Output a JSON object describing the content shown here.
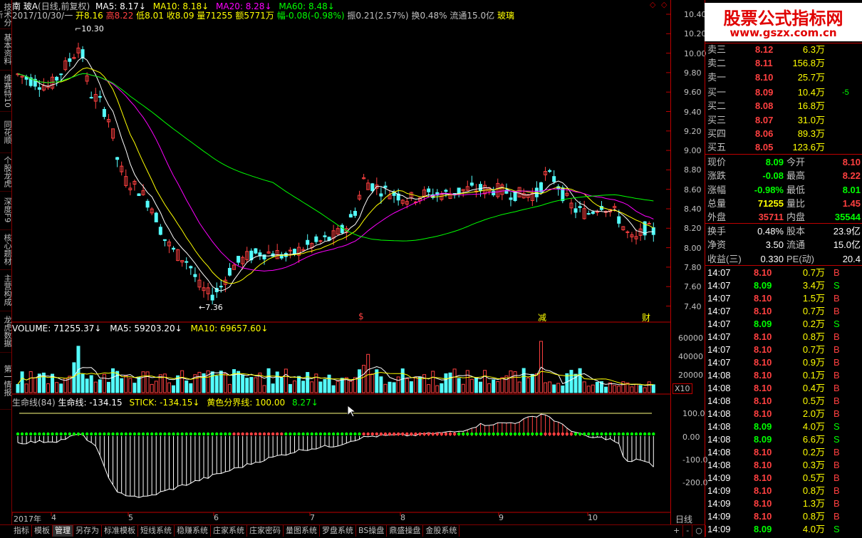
{
  "left_tabs": [
    "技术分析",
    "基本资料",
    "维赛特10",
    "同花顺",
    "个股龙虎",
    "深度F9",
    "核心题材",
    "主营构成",
    "龙虎数据",
    "第一情报"
  ],
  "header": {
    "stock": "南 玻A",
    "mode": "(日线,前复权)",
    "ma5": "MA5: 8.17",
    "ma10": "MA10: 8.18",
    "ma20": "MA20: 8.28",
    "ma60": "MA60: 8.48",
    "date": "2017/10/30/一",
    "open": "开8.16",
    "high": "高8.22",
    "low": "低8.01",
    "close": "收8.09",
    "vol": "量71255",
    "amount": "额5771万",
    "change": "幅-0.08(-0.98%)",
    "amp": "振0.21(2.57%)",
    "turnover": "换0.48%",
    "float": "流通15.0亿",
    "industry": "玻璃"
  },
  "annotations": {
    "high_mark": "10.30",
    "low_mark": "7.36",
    "m1": "$",
    "m2": "减",
    "m3": "财"
  },
  "price_axis": [
    "10.40",
    "10.20",
    "10.00",
    "9.80",
    "9.60",
    "9.40",
    "9.20",
    "9.00",
    "8.80",
    "8.60",
    "8.40",
    "8.20",
    "8.00",
    "7.80",
    "7.60",
    "7.40"
  ],
  "volume_header": {
    "vol": "VOLUME: 71255.37",
    "ma5": "MA5: 59203.20",
    "ma10": "MA10: 69657.60"
  },
  "volume_axis": [
    "60000",
    "40000",
    "20000"
  ],
  "volume_unit": "X10",
  "ind_header": {
    "name": "生命线(84)",
    "life": "生命线: -134.15",
    "stick": "STICK: -134.15",
    "yellow": "黄色分界线: 100.00",
    "extra": "8.27"
  },
  "ind_axis": [
    "100.0",
    "0.00",
    "-100.0",
    "-200.0"
  ],
  "x_axis": [
    "2017年",
    "4",
    "5",
    "6",
    "7",
    "8",
    "9",
    "10"
  ],
  "period": "日线",
  "bottom_tabs": [
    "指标",
    "模板",
    "管理",
    "另存为",
    "标准模板",
    "短线系统",
    "稳赚系统",
    "庄家系统",
    "庄家密码",
    "量图系统",
    "罗盘系统",
    "BS操盘",
    "鼎盛操盘",
    "金股系统"
  ],
  "bottom_controls": [
    "+",
    "-",
    "○"
  ],
  "logo": {
    "title": "股票公式指标网",
    "url": "www.gszx.com.cn"
  },
  "order_book": [
    {
      "label": "卖三",
      "price": "8.12",
      "vol": "6.3万"
    },
    {
      "label": "卖二",
      "price": "8.11",
      "vol": "156.8万"
    },
    {
      "label": "卖一",
      "price": "8.10",
      "vol": "25.7万"
    },
    {
      "label": "买一",
      "price": "8.09",
      "vol": "10.4万",
      "extra": "-5"
    },
    {
      "label": "买二",
      "price": "8.08",
      "vol": "16.8万"
    },
    {
      "label": "买三",
      "price": "8.07",
      "vol": "31.0万"
    },
    {
      "label": "买四",
      "price": "8.06",
      "vol": "89.3万"
    },
    {
      "label": "买五",
      "price": "8.05",
      "vol": "123.6万"
    }
  ],
  "quote": [
    {
      "l1": "现价",
      "v1": "8.09",
      "l2": "今开",
      "v2": "8.10"
    },
    {
      "l1": "涨跌",
      "v1": "-0.08",
      "l2": "最高",
      "v2": "8.22"
    },
    {
      "l1": "涨幅",
      "v1": "-0.98%",
      "l2": "最低",
      "v2": "8.01"
    },
    {
      "l1": "总量",
      "v1": "71255",
      "l2": "量比",
      "v2": "1.45"
    },
    {
      "l1": "外盘",
      "v1": "35711",
      "l2": "内盘",
      "v2": "35544"
    }
  ],
  "stats": [
    {
      "l1": "换手",
      "v1": "0.48%",
      "l2": "股本",
      "v2": "23.9亿"
    },
    {
      "l1": "净资",
      "v1": "3.50",
      "l2": "流通",
      "v2": "15.0亿"
    },
    {
      "l1": "收益(三)",
      "v1": "0.330",
      "l2": "PE(动)",
      "v2": "20.4"
    }
  ],
  "ticks": [
    {
      "t": "14:07",
      "p": "8.10",
      "v": "0.7万",
      "s": "B"
    },
    {
      "t": "14:07",
      "p": "8.09",
      "v": "3.4万",
      "s": "S"
    },
    {
      "t": "14:07",
      "p": "8.10",
      "v": "1.5万",
      "s": "B"
    },
    {
      "t": "14:07",
      "p": "8.10",
      "v": "0.7万",
      "s": "B"
    },
    {
      "t": "14:07",
      "p": "8.09",
      "v": "0.2万",
      "s": "S"
    },
    {
      "t": "14:07",
      "p": "8.10",
      "v": "0.8万",
      "s": "B"
    },
    {
      "t": "14:07",
      "p": "8.10",
      "v": "0.7万",
      "s": "B"
    },
    {
      "t": "14:07",
      "p": "8.10",
      "v": "0.9万",
      "s": "B"
    },
    {
      "t": "14:08",
      "p": "8.10",
      "v": "0.1万",
      "s": "B"
    },
    {
      "t": "14:08",
      "p": "8.10",
      "v": "0.4万",
      "s": "B"
    },
    {
      "t": "14:08",
      "p": "8.10",
      "v": "0.5万",
      "s": "B"
    },
    {
      "t": "14:08",
      "p": "8.10",
      "v": "2.0万",
      "s": "B"
    },
    {
      "t": "14:08",
      "p": "8.09",
      "v": "4.0万",
      "s": "S"
    },
    {
      "t": "14:08",
      "p": "8.09",
      "v": "6.6万",
      "s": "S"
    },
    {
      "t": "14:08",
      "p": "8.10",
      "v": "0.2万",
      "s": "B"
    },
    {
      "t": "14:08",
      "p": "8.10",
      "v": "0.3万",
      "s": "B"
    },
    {
      "t": "14:09",
      "p": "8.10",
      "v": "0.5万",
      "s": "B"
    },
    {
      "t": "14:09",
      "p": "8.10",
      "v": "0.8万",
      "s": "B"
    },
    {
      "t": "14:09",
      "p": "8.10",
      "v": "1.3万",
      "s": "B"
    },
    {
      "t": "14:09",
      "p": "8.10",
      "v": "0.8万",
      "s": "B"
    },
    {
      "t": "14:09",
      "p": "8.09",
      "v": "4.0万",
      "s": "S"
    }
  ]
}
